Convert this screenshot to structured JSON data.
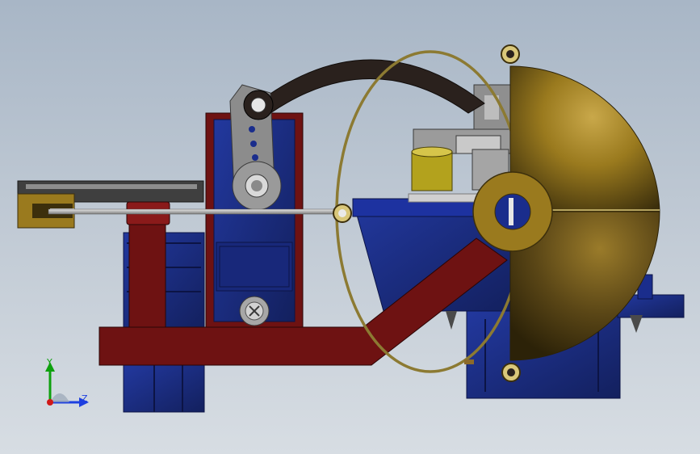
{
  "viewport": {
    "background_top": "#a8b6c6",
    "background_bottom": "#d7dde3"
  },
  "model": {
    "parts": [
      {
        "name": "frame-plate",
        "color": "#6e1212"
      },
      {
        "name": "servo-housing",
        "color": "#1a2d8c"
      },
      {
        "name": "brass-hemisphere",
        "color": "#9a7a1e"
      },
      {
        "name": "brass-ring",
        "color": "#8c7a32"
      },
      {
        "name": "dark-arc-link",
        "color": "#2a211d"
      },
      {
        "name": "gray-linkage",
        "color": "#9a9a9a"
      },
      {
        "name": "push-rod",
        "color": "#bfbfbf"
      },
      {
        "name": "yellow-cylinder",
        "color": "#b3a21d"
      }
    ]
  },
  "triad": {
    "y_label": "Y",
    "z_label": "Z",
    "y_color": "#0ea10e",
    "z_color": "#1d3fe0",
    "origin_color": "#d01818"
  }
}
